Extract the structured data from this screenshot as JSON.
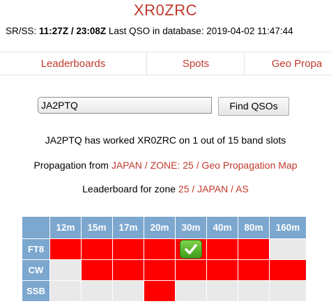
{
  "header": {
    "title": "XR0ZRC",
    "srss_label": "SR/SS:",
    "sunrise": "11:27Z",
    "separator": "/",
    "sunset": "23:08Z",
    "last_qso_label": "Last QSO in database:",
    "last_qso_value": "2019-04-02 11:47:44"
  },
  "nav": {
    "items": [
      {
        "label": "Leaderboards"
      },
      {
        "label": "Spots"
      },
      {
        "label": "Geo Propa"
      }
    ]
  },
  "search": {
    "value": "JA2PTQ",
    "button_label": "Find QSOs"
  },
  "summary": {
    "text": "JA2PTQ has worked XR0ZRC on 1 out of 15 band slots"
  },
  "propagation": {
    "prefix": "Propagation",
    "from": "from",
    "country": "JAPAN",
    "sep1": "/",
    "zone": "ZONE: 25",
    "sep2": "/",
    "map": "Geo Propagation Map"
  },
  "leaderboard": {
    "prefix": "Leaderboard",
    "for_zone": "for zone",
    "zone": "25",
    "sep1": "/",
    "country": "JAPAN",
    "sep2": "/",
    "continent": "AS"
  },
  "grid": {
    "bands": [
      "12m",
      "15m",
      "17m",
      "20m",
      "30m",
      "40m",
      "80m",
      "160m"
    ],
    "rows": [
      {
        "mode": "FT8",
        "cells": [
          "red",
          "red",
          "red",
          "red",
          "check",
          "red",
          "red",
          "empty"
        ]
      },
      {
        "mode": "CW",
        "cells": [
          "empty",
          "red",
          "red",
          "red",
          "red",
          "red",
          "red",
          "red"
        ]
      },
      {
        "mode": "SSB",
        "cells": [
          "empty",
          "empty",
          "empty",
          "red",
          "empty",
          "empty",
          "empty",
          "empty"
        ]
      }
    ],
    "colors": {
      "worked": "#ff0000",
      "empty": "#e9e9e9",
      "header": "#7ca7cf"
    }
  }
}
